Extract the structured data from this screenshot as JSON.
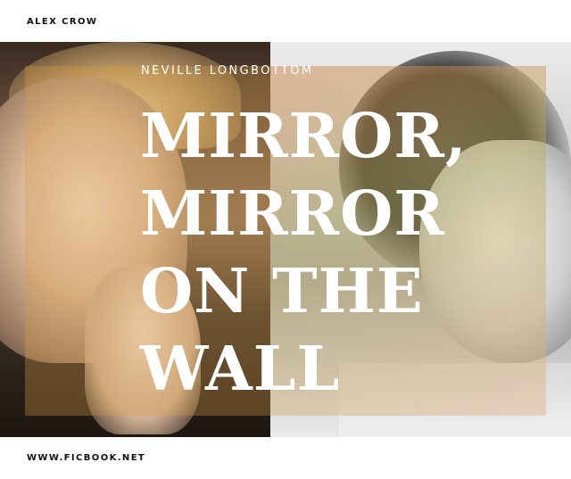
{
  "author": "ALEX CROW",
  "subtitle": "NEVILLE LONGBOTTOM",
  "title_lines": [
    "MIRROR,",
    "MIRROR",
    "ON THE",
    "WALL"
  ],
  "website": "WWW.FICBOOK.NET",
  "colors": {
    "background": "#ffffff",
    "text_dark": "#111111",
    "text_light": "#ffffff",
    "overlay_tint": "#d6a046"
  }
}
